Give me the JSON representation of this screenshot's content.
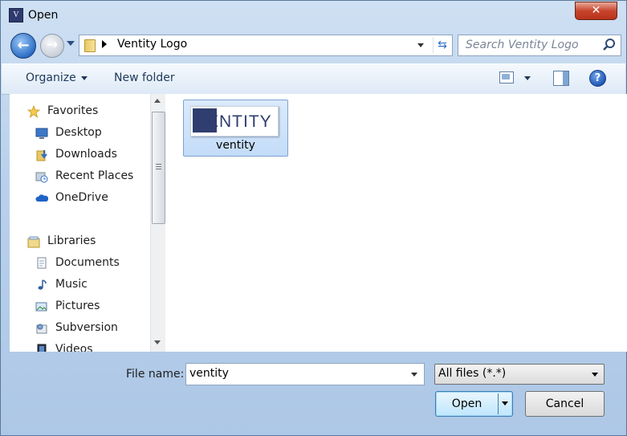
{
  "window": {
    "title": "Open",
    "app_icon_letter": "V",
    "close_glyph": "✕"
  },
  "nav": {
    "back_glyph": "←",
    "forward_glyph": "→",
    "breadcrumb": "Ventity Logo",
    "refresh_glyph": "⇆",
    "search_placeholder": "Search Ventity Logo"
  },
  "toolbar": {
    "organize_label": "Organize",
    "new_folder_label": "New folder",
    "help_glyph": "?"
  },
  "sidebar": {
    "favorites": {
      "label": "Favorites",
      "items": [
        {
          "label": "Desktop",
          "icon": "desktop-icon"
        },
        {
          "label": "Downloads",
          "icon": "downloads-icon"
        },
        {
          "label": "Recent Places",
          "icon": "recent-places-icon"
        },
        {
          "label": "OneDrive",
          "icon": "onedrive-icon"
        }
      ]
    },
    "libraries": {
      "label": "Libraries",
      "items": [
        {
          "label": "Documents",
          "icon": "documents-icon"
        },
        {
          "label": "Music",
          "icon": "music-icon"
        },
        {
          "label": "Pictures",
          "icon": "pictures-icon"
        },
        {
          "label": "Subversion",
          "icon": "subversion-icon"
        },
        {
          "label": "Videos",
          "icon": "videos-icon"
        }
      ]
    }
  },
  "files": [
    {
      "name": "ventity",
      "thumbnail_text": "ENTITY",
      "selected": true
    }
  ],
  "footer": {
    "file_name_label": "File name:",
    "file_name_value": "ventity",
    "filter_value": "All files (*.*)",
    "open_label": "Open",
    "cancel_label": "Cancel"
  },
  "colors": {
    "selection": "#c3dcf8",
    "accent": "#2f6fc6",
    "logo": "#2f3d6f"
  }
}
